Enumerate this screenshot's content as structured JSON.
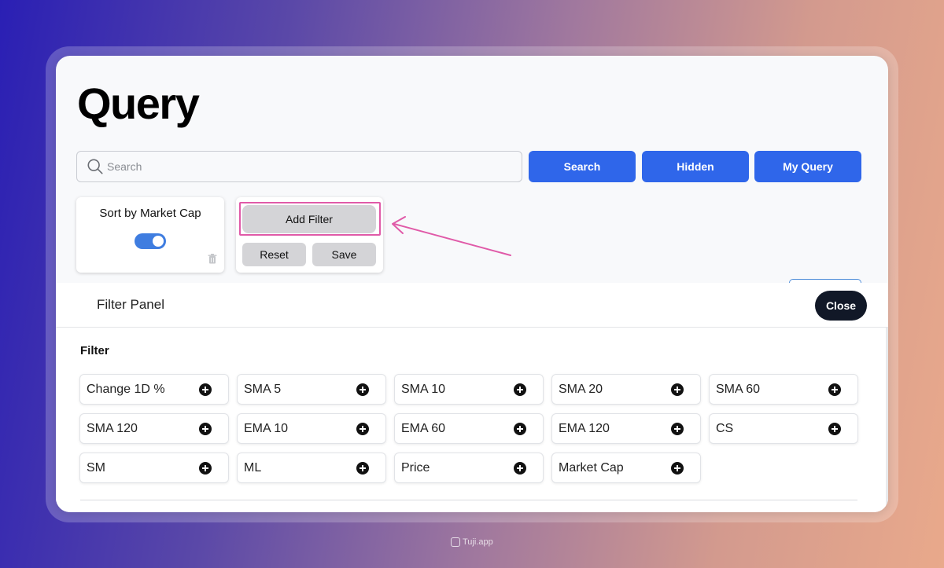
{
  "page": {
    "title": "Query"
  },
  "search": {
    "placeholder": "Search"
  },
  "toolbar": {
    "search_label": "Search",
    "hidden_label": "Hidden",
    "my_query_label": "My Query"
  },
  "sort_card": {
    "label": "Sort by Market Cap",
    "toggle_on": true
  },
  "filter_actions": {
    "add_filter_label": "Add Filter",
    "reset_label": "Reset",
    "save_label": "Save"
  },
  "panel": {
    "title": "Filter Panel",
    "close_label": "Close",
    "section_heading": "Filter",
    "filters": [
      {
        "label": "Change 1D %"
      },
      {
        "label": "SMA 5"
      },
      {
        "label": "SMA 10"
      },
      {
        "label": "SMA 20"
      },
      {
        "label": "SMA 60"
      },
      {
        "label": "SMA 120"
      },
      {
        "label": "EMA 10"
      },
      {
        "label": "EMA 60"
      },
      {
        "label": "EMA 120"
      },
      {
        "label": "CS"
      },
      {
        "label": "SM"
      },
      {
        "label": "ML"
      },
      {
        "label": "Price"
      },
      {
        "label": "Market Cap"
      }
    ]
  },
  "watermark": {
    "text": "Tuji.app"
  },
  "colors": {
    "primary_button": "#2f66ea",
    "highlight_outline": "#e05aa8",
    "close_button": "#111827",
    "toggle": "#3f7de0"
  }
}
